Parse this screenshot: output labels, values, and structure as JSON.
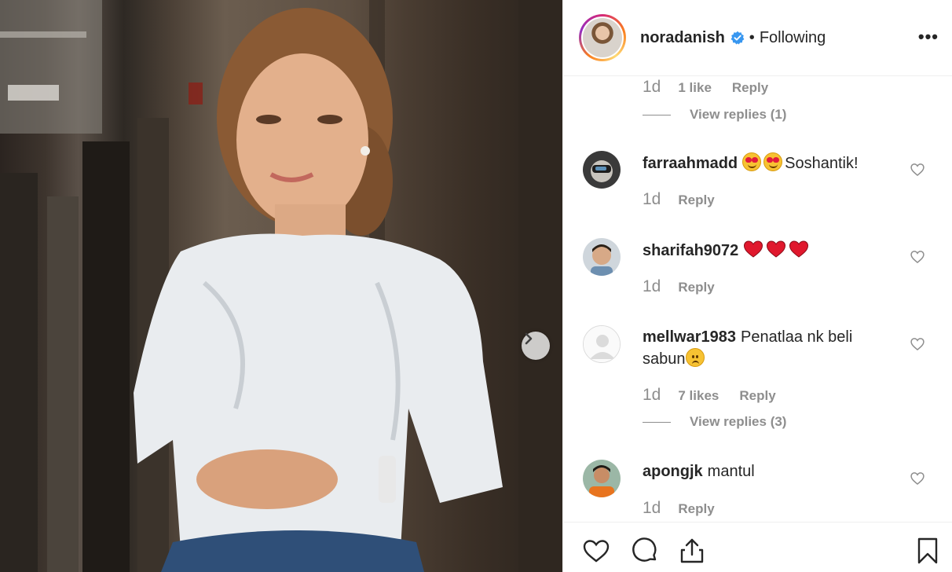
{
  "post": {
    "author": "noradanish",
    "verified": true,
    "separator": "•",
    "follow_status": "Following",
    "more_label": "•••"
  },
  "comments": {
    "prev_tail": {
      "time": "1d",
      "likes": "1 like",
      "reply": "Reply",
      "view_replies": "View replies (1)"
    },
    "items": [
      {
        "user": "farraahmadd",
        "text": "Soshantik!",
        "emojis": [
          "heart-eyes-emoji",
          "heart-eyes-emoji"
        ],
        "time": "1d",
        "reply": "Reply"
      },
      {
        "user": "sharifah9072",
        "text": "",
        "emojis": [
          "red-heart-emoji",
          "red-heart-emoji",
          "red-heart-emoji"
        ],
        "time": "1d",
        "reply": "Reply"
      },
      {
        "user": "mellwar1983",
        "text_line1": "Penatlaa nk beli",
        "text_line2": "sabun",
        "emojis": [
          "sad-face-emoji"
        ],
        "time": "1d",
        "likes": "7 likes",
        "reply": "Reply",
        "view_replies": "View replies (3)"
      },
      {
        "user": "apongjk",
        "text": "mantul",
        "time": "1d",
        "reply": "Reply"
      }
    ]
  },
  "colors": {
    "text": "#262626",
    "muted": "#8e8e8e",
    "verified": "#3897f0",
    "border": "#efefef",
    "heart_red": "#e0182d"
  },
  "icons": {
    "next": "chevron-right-icon",
    "like": "heart-icon",
    "comment": "comment-icon",
    "share": "share-icon",
    "save": "bookmark-icon",
    "more": "more-options-icon"
  }
}
